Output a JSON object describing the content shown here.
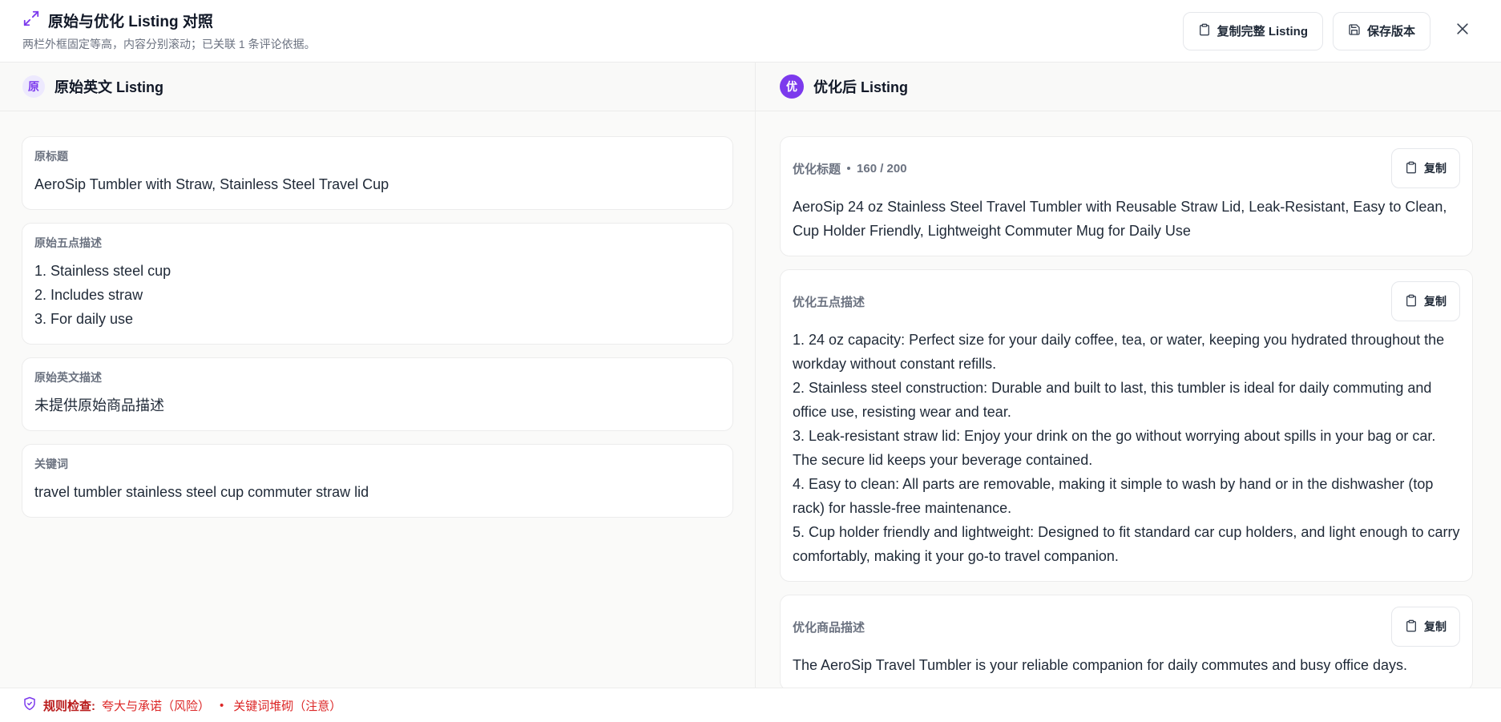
{
  "header": {
    "title": "原始与优化 Listing 对照",
    "subtitle": "两栏外框固定等高，内容分别滚动；已关联 1 条评论依据。",
    "copy_full_label": "复制完整 Listing",
    "save_version_label": "保存版本",
    "accent_color": "#7c3aed"
  },
  "left": {
    "badge": "原",
    "title": "原始英文 Listing",
    "cards": [
      {
        "label": "原标题",
        "lines": [
          "AeroSip Tumbler with Straw, Stainless Steel Travel Cup"
        ]
      },
      {
        "label": "原始五点描述",
        "lines": [
          "1. Stainless steel cup",
          "2. Includes straw",
          "3. For daily use"
        ]
      },
      {
        "label": "原始英文描述",
        "lines": [
          "未提供原始商品描述"
        ]
      },
      {
        "label": "关键词",
        "lines": [
          "travel tumbler stainless steel cup commuter straw lid"
        ]
      }
    ]
  },
  "right": {
    "badge": "优",
    "title": "优化后 Listing",
    "copy_label": "复制",
    "title_card": {
      "label": "优化标题",
      "count": "160 / 200",
      "text": "AeroSip 24 oz Stainless Steel Travel Tumbler with Reusable Straw Lid, Leak-Resistant, Easy to Clean, Cup Holder Friendly, Lightweight Commuter Mug for Daily Use"
    },
    "bullets_card": {
      "label": "优化五点描述",
      "lines": [
        "1. 24 oz capacity: Perfect size for your daily coffee, tea, or water, keeping you hydrated throughout the workday without constant refills.",
        "2. Stainless steel construction: Durable and built to last, this tumbler is ideal for daily commuting and office use, resisting wear and tear.",
        "3. Leak-resistant straw lid: Enjoy your drink on the go without worrying about spills in your bag or car. The secure lid keeps your beverage contained.",
        "4. Easy to clean: All parts are removable, making it simple to wash by hand or in the dishwasher (top rack) for hassle-free maintenance.",
        "5. Cup holder friendly and lightweight: Designed to fit standard car cup holders, and light enough to carry comfortably, making it your go-to travel companion."
      ]
    },
    "desc_card": {
      "label": "优化商品描述",
      "text": "The AeroSip Travel Tumbler is your reliable companion for daily commutes and busy office days."
    }
  },
  "footer": {
    "label": "规则检查:",
    "items": [
      "夸大与承诺（风险）",
      "关键词堆砌（注意）"
    ],
    "separator": "•",
    "color": "#dc2626"
  }
}
